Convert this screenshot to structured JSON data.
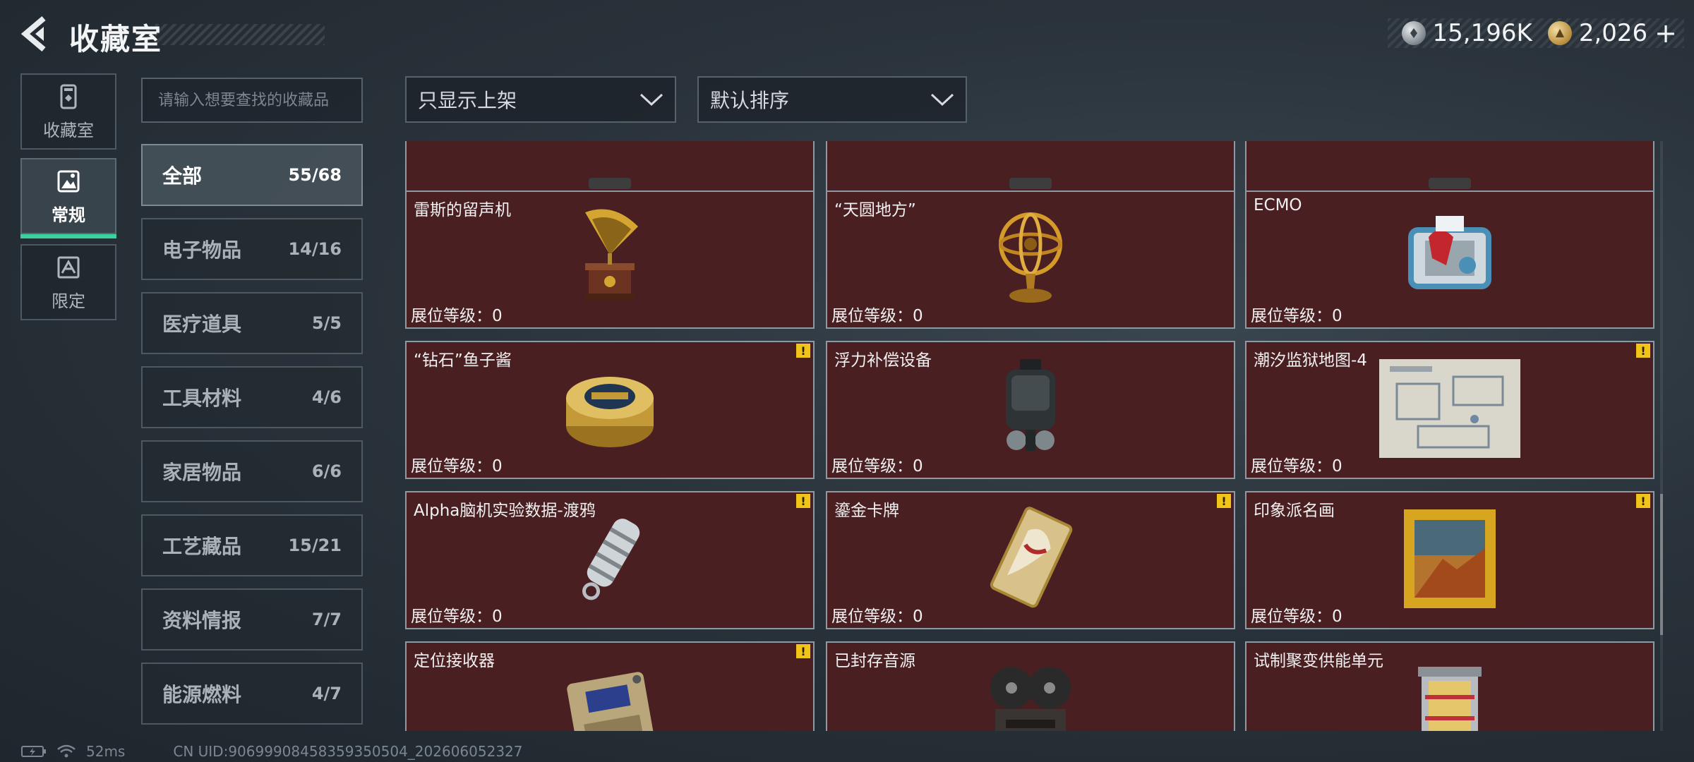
{
  "header": {
    "title": "收藏室",
    "currency": [
      {
        "icon": "silver-coin-icon",
        "value": "15,196K"
      },
      {
        "icon": "gold-coin-icon",
        "value": "2,026"
      }
    ],
    "add_label": "+"
  },
  "nav": [
    {
      "label": "收藏室",
      "icon": "collection-room-icon",
      "active": false
    },
    {
      "label": "常规",
      "icon": "regular-icon",
      "active": true
    },
    {
      "label": "限定",
      "icon": "limited-icon",
      "active": false
    }
  ],
  "search": {
    "placeholder": "请输入想要查找的收藏品"
  },
  "filters": {
    "shelf": "只显示上架",
    "sort": "默认排序"
  },
  "categories": [
    {
      "name": "全部",
      "count": "55/68",
      "active": true
    },
    {
      "name": "电子物品",
      "count": "14/16"
    },
    {
      "name": "医疗道具",
      "count": "5/5"
    },
    {
      "name": "工具材料",
      "count": "4/6"
    },
    {
      "name": "家居物品",
      "count": "6/6"
    },
    {
      "name": "工艺藏品",
      "count": "15/21"
    },
    {
      "name": "资料情报",
      "count": "7/7"
    },
    {
      "name": "能源燃料",
      "count": "4/7"
    }
  ],
  "level_label": "展位等级：",
  "items": [
    {
      "name": "",
      "level": "0",
      "warn": false,
      "art": "partial"
    },
    {
      "name": "",
      "level": "0",
      "warn": false,
      "art": "partial"
    },
    {
      "name": "",
      "level": "0",
      "warn": false,
      "art": "partial"
    },
    {
      "name": "雷斯的留声机",
      "level": "0",
      "warn": false,
      "art": "gramophone"
    },
    {
      "name": "“天圆地方”",
      "level": "0",
      "warn": false,
      "art": "armillary"
    },
    {
      "name": "ECMO",
      "level": "0",
      "warn": false,
      "art": "ecmo"
    },
    {
      "name": "“钻石”鱼子酱",
      "level": "0",
      "warn": true,
      "art": "caviar"
    },
    {
      "name": "浮力补偿设备",
      "level": "0",
      "warn": false,
      "art": "bcd"
    },
    {
      "name": "潮汐监狱地图-4",
      "level": "0",
      "warn": true,
      "art": "map"
    },
    {
      "name": "Alpha脑机实验数据-渡鸦",
      "level": "0",
      "warn": true,
      "art": "cylinder"
    },
    {
      "name": "鎏金卡牌",
      "level": "0",
      "warn": true,
      "art": "card"
    },
    {
      "name": "印象派名画",
      "level": "0",
      "warn": true,
      "art": "painting"
    },
    {
      "name": "定位接收器",
      "level": "",
      "warn": true,
      "art": "receiver"
    },
    {
      "name": "已封存音源",
      "level": "",
      "warn": false,
      "art": "reel"
    },
    {
      "name": "试制聚变供能单元",
      "level": "",
      "warn": false,
      "art": "fusion"
    }
  ],
  "footer": {
    "ping": "52ms",
    "uid": "CN UID:9069990845835935​0504_202606052327"
  }
}
